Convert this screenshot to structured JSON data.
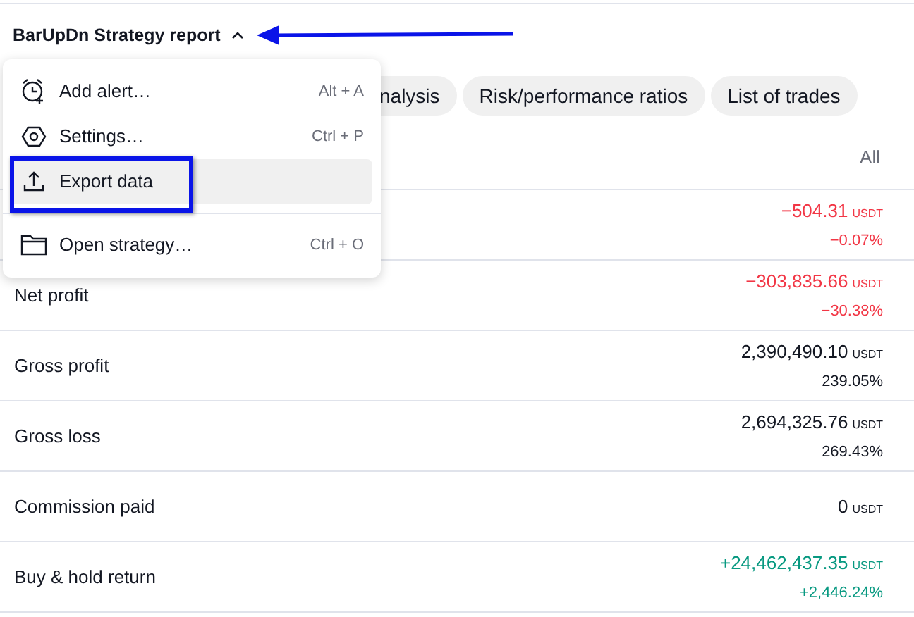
{
  "title": "BarUpDn Strategy report",
  "tabs": [
    {
      "label": "nalysis",
      "selected": false
    },
    {
      "label": "Risk/performance ratios",
      "selected": false
    },
    {
      "label": "List of trades",
      "selected": false
    }
  ],
  "table": {
    "column_header": "All",
    "rows": [
      {
        "value": "−504.31",
        "unit": "USDT",
        "percent": "−0.07%",
        "color": "#f23645"
      },
      {
        "label": "Net profit",
        "value": "−303,835.66",
        "unit": "USDT",
        "percent": "−30.38%",
        "color": "#f23645"
      },
      {
        "label": "Gross profit",
        "value": "2,390,490.10",
        "unit": "USDT",
        "percent": "239.05%",
        "color": "#131722"
      },
      {
        "label": "Gross loss",
        "value": "2,694,325.76",
        "unit": "USDT",
        "percent": "269.43%",
        "color": "#131722"
      },
      {
        "label": "Commission paid",
        "value": "0",
        "unit": "USDT",
        "color": "#131722"
      },
      {
        "label": "Buy & hold return",
        "value": "+24,462,437.35",
        "unit": "USDT",
        "percent": "+2,446.24%",
        "color": "#089981"
      }
    ]
  },
  "menu": {
    "items": [
      {
        "kind": "alert",
        "label": "Add alert…",
        "shortcut": "Alt + A",
        "selected": false
      },
      {
        "kind": "settings",
        "label": "Settings…",
        "shortcut": "Ctrl + P",
        "selected": false
      },
      {
        "kind": "export",
        "label": "Export data",
        "selected": true
      },
      {
        "kind": "divider"
      },
      {
        "kind": "folder",
        "label": "Open strategy…",
        "shortcut": "Ctrl + O",
        "selected": false
      }
    ]
  }
}
